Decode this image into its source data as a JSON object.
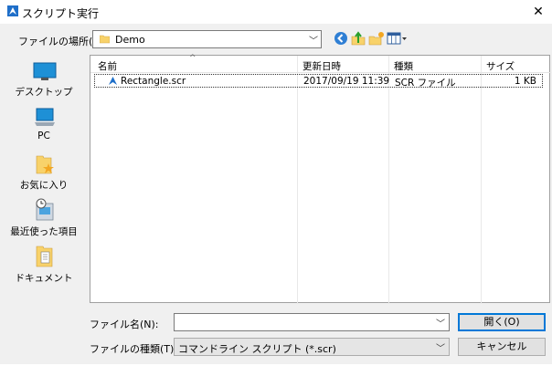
{
  "window": {
    "title": "スクリプト実行",
    "close": "✕"
  },
  "lookin": {
    "label": "ファイルの場所(I):",
    "value": "Demo"
  },
  "places": [
    {
      "label": "デスクトップ",
      "icon": "desktop-icon"
    },
    {
      "label": "PC",
      "icon": "pc-icon"
    },
    {
      "label": "お気に入り",
      "icon": "favorites-icon"
    },
    {
      "label": "最近使った項目",
      "icon": "recent-items-icon"
    },
    {
      "label": "ドキュメント",
      "icon": "documents-icon"
    }
  ],
  "columns": {
    "name": "名前",
    "date": "更新日時",
    "type": "種類",
    "size": "サイズ"
  },
  "files": [
    {
      "name": "Rectangle.scr",
      "date": "2017/09/19 11:39",
      "type": "SCR ファイル",
      "size": "1 KB"
    }
  ],
  "filename": {
    "label": "ファイル名(N):",
    "value": ""
  },
  "filetype": {
    "label": "ファイルの種類(T):",
    "value": "コマンドライン スクリプト (*.scr)"
  },
  "buttons": {
    "open": "開く(O)",
    "cancel": "キャンセル"
  },
  "colors": {
    "accent": "#0078d7",
    "folder": "#f8d26a"
  }
}
